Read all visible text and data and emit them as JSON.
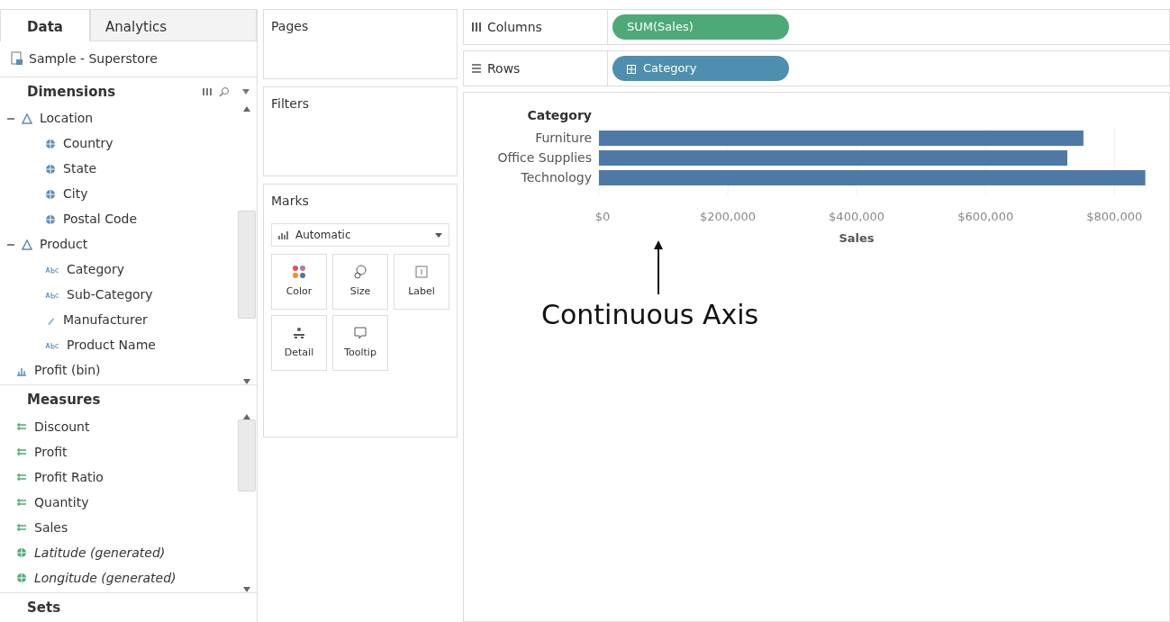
{
  "data_pane": {
    "tabs": [
      {
        "label": "Data",
        "selected": true
      },
      {
        "label": "Analytics",
        "selected": false
      }
    ],
    "data_source": "Sample - Superstore",
    "dimensions": {
      "title": "Dimensions",
      "items": [
        {
          "label": "Location",
          "kind": "group",
          "expanded": true,
          "children": [
            {
              "label": "Country",
              "kind": "geo"
            },
            {
              "label": "State",
              "kind": "geo"
            },
            {
              "label": "City",
              "kind": "geo"
            },
            {
              "label": "Postal Code",
              "kind": "geo"
            }
          ]
        },
        {
          "label": "Product",
          "kind": "group",
          "expanded": true,
          "children": [
            {
              "label": "Category",
              "kind": "string"
            },
            {
              "label": "Sub-Category",
              "kind": "string"
            },
            {
              "label": "Manufacturer",
              "kind": "clip"
            },
            {
              "label": "Product Name",
              "kind": "string"
            }
          ]
        },
        {
          "label": "Profit (bin)",
          "kind": "bin"
        }
      ]
    },
    "measures": {
      "title": "Measures",
      "items": [
        {
          "label": "Discount",
          "kind": "measure"
        },
        {
          "label": "Profit",
          "kind": "measure"
        },
        {
          "label": "Profit Ratio",
          "kind": "measure"
        },
        {
          "label": "Quantity",
          "kind": "measure"
        },
        {
          "label": "Sales",
          "kind": "measure"
        },
        {
          "label": "Latitude (generated)",
          "kind": "generated"
        },
        {
          "label": "Longitude (generated)",
          "kind": "generated"
        }
      ]
    },
    "sets": {
      "title": "Sets"
    }
  },
  "cards": {
    "pages": "Pages",
    "filters": "Filters",
    "marks": {
      "title": "Marks",
      "mark_type": "Automatic",
      "buttons": [
        {
          "label": "Color",
          "kind": "color"
        },
        {
          "label": "Size",
          "kind": "size"
        },
        {
          "label": "Label",
          "kind": "label"
        },
        {
          "label": "Detail",
          "kind": "detail"
        },
        {
          "label": "Tooltip",
          "kind": "tooltip"
        }
      ]
    }
  },
  "shelves": [
    {
      "label": "Columns",
      "kind": "columns",
      "pill": {
        "text": "SUM(Sales)",
        "color": "#4daa78"
      }
    },
    {
      "label": "Rows",
      "kind": "rows",
      "pill": {
        "text": "Category",
        "color": "#4e8fb0"
      }
    }
  ],
  "view": {
    "chart_data": {
      "type": "bar",
      "orientation": "horizontal",
      "title": "Category",
      "xlabel": "Sales",
      "categories": [
        "Furniture",
        "Office Supplies",
        "Technology"
      ],
      "series": [
        {
          "color": "#4e79a7",
          "values": [
            752000,
            727000,
            848000
          ]
        }
      ],
      "grid": true,
      "xlim": [
        0,
        850000
      ],
      "xticks": [
        {
          "value": 0,
          "label": "$0"
        },
        {
          "value": 200000,
          "label": "$200,000"
        },
        {
          "value": 400000,
          "label": "$400,000"
        },
        {
          "value": 600000,
          "label": "$600,000"
        },
        {
          "value": 800000,
          "label": "$800,000"
        }
      ]
    },
    "annotation": "Continuous Axis"
  }
}
